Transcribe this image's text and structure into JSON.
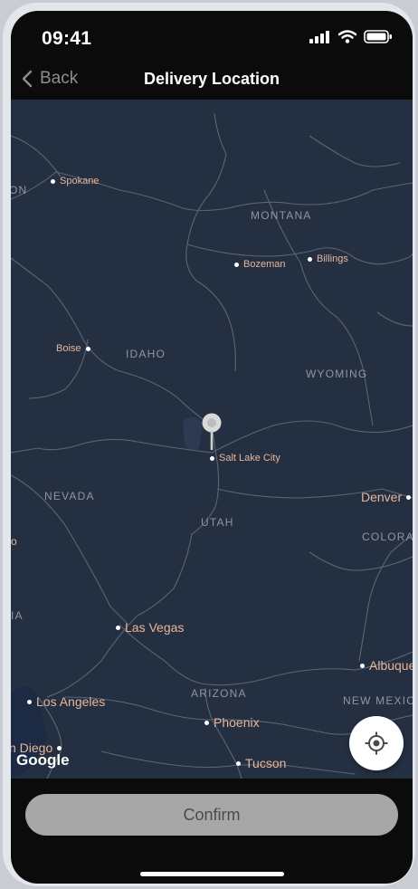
{
  "status_bar": {
    "time": "09:41",
    "icons": [
      "signal-icon",
      "wifi-icon",
      "battery-icon"
    ]
  },
  "navbar": {
    "back_label": "Back",
    "title": "Delivery Location"
  },
  "map": {
    "cities": [
      {
        "name": "Spokane"
      },
      {
        "name": "Bozeman"
      },
      {
        "name": "Billings"
      },
      {
        "name": "Boise"
      },
      {
        "name": "Salt Lake City"
      },
      {
        "name": "Denver"
      },
      {
        "name": "Las Vegas"
      },
      {
        "name": "Los Angeles"
      },
      {
        "name": "Phoenix"
      },
      {
        "name": "Albuque"
      },
      {
        "name": "n Diego"
      },
      {
        "name": "Tucson"
      }
    ],
    "states": [
      "ON",
      "MONTANA",
      "IDAHO",
      "WYOMING",
      "NEVADA",
      "UTAH",
      "COLORA",
      "ARIZONA",
      "NEW MEXICO",
      "IA",
      "o"
    ],
    "attribution": "Google",
    "colors": {
      "land": "#243041",
      "roads": "#5b6673",
      "water": "#1c2a44",
      "label": "#e8b598"
    }
  },
  "actions": {
    "confirm_label": "Confirm",
    "locate_icon": "crosshair-icon",
    "pin_icon": "map-pin-icon"
  }
}
